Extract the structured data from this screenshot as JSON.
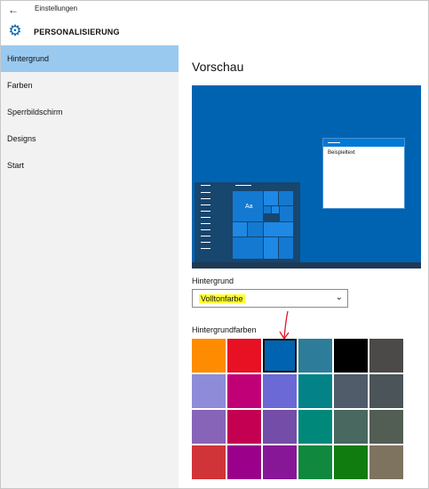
{
  "titlebar": {
    "title": "Einstellungen",
    "back_icon": "back-arrow-icon"
  },
  "header": {
    "app_title": "PERSONALISIERUNG",
    "icon": "gear-icon"
  },
  "sidebar": {
    "items": [
      {
        "label": "Hintergrund",
        "selected": true
      },
      {
        "label": "Farben",
        "selected": false
      },
      {
        "label": "Sperrbildschirm",
        "selected": false
      },
      {
        "label": "Designs",
        "selected": false
      },
      {
        "label": "Start",
        "selected": false
      }
    ]
  },
  "main": {
    "section_title": "Vorschau",
    "preview": {
      "sample_text": "Beispieltext",
      "tile_text": "Aa"
    },
    "background_label": "Hintergrund",
    "background_value": "Volltonfarbe",
    "colors_label": "Hintergrundfarben",
    "swatches": [
      [
        "#ff8c00",
        "#e81123",
        "#0063b1",
        "#2d7d9a",
        "#000000",
        "#4c4a48"
      ],
      [
        "#8e8cd8",
        "#bf0077",
        "#6b69d6",
        "#038387",
        "#515c6b",
        "#4a5459"
      ],
      [
        "#8764b8",
        "#c30052",
        "#744da9",
        "#00897b",
        "#486860",
        "#525e54"
      ],
      [
        "#d13438",
        "#9a0089",
        "#881798",
        "#10893e",
        "#107c10",
        "#7e735f"
      ]
    ],
    "selected_swatch": "#0063b1"
  },
  "colors": {
    "accent": "#0063b1",
    "sidebar_bg": "#f2f2f2",
    "selected_nav": "#99c9ef",
    "highlight": "#ffff33",
    "annotation": "#e81123"
  }
}
